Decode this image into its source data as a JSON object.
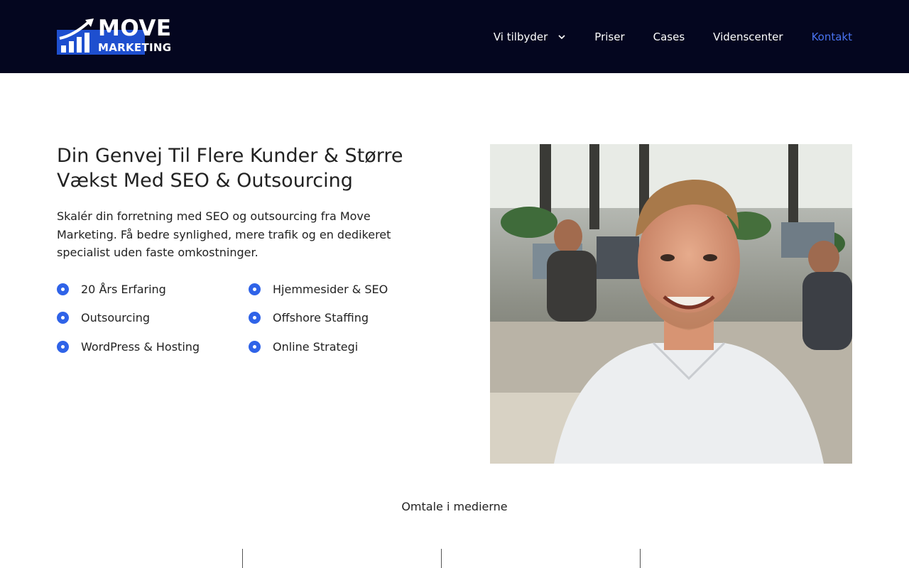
{
  "brand": {
    "logo_word1": "MOVE",
    "logo_word2": "MARKETING",
    "header_bg": "#04061f",
    "accent": "#2f63e8",
    "logo_blue": "#1e4fcf"
  },
  "nav": {
    "items": [
      {
        "label": "Vi tilbyder",
        "has_dropdown": true,
        "icon": "chevron-down-icon"
      },
      {
        "label": "Priser"
      },
      {
        "label": "Cases"
      },
      {
        "label": "Videnscenter"
      },
      {
        "label": "Kontakt",
        "active": true
      }
    ],
    "active_color": "#4a73f0"
  },
  "hero": {
    "title": "Din Genvej Til Flere Kunder & Større Vækst Med SEO & Outsourcing",
    "text": "Skalér din forretning med SEO og outsourcing fra Move Marketing. Få bedre synlighed, mere trafik og en dedikeret specialist uden faste omkostninger.",
    "features": [
      "20 Års Erfaring",
      "Hjemmesider & SEO",
      "Outsourcing",
      "Offshore Staffing",
      "WordPress & Hosting",
      "Online Strategi"
    ],
    "photo_icon": "portrait-photo"
  },
  "media": {
    "title": "Omtale i medierne"
  }
}
